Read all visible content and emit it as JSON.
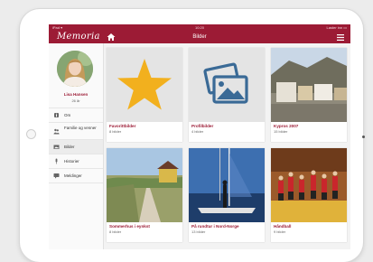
{
  "app": {
    "logo": "Memoria",
    "page_title": "Bilder"
  },
  "statusbar": {
    "left": "iPad ▾",
    "time": "10:20",
    "right": "Laster inn ▭"
  },
  "profile": {
    "name": "Lisa Hansen",
    "age": "26 år"
  },
  "menu": [
    {
      "label": "Om",
      "icon": "info-icon",
      "active": false
    },
    {
      "label": "Familie og venner",
      "icon": "people-icon",
      "active": false
    },
    {
      "label": "Bilder",
      "icon": "photos-icon",
      "active": true
    },
    {
      "label": "Historier",
      "icon": "microphone-icon",
      "active": false
    },
    {
      "label": "Meldinger",
      "icon": "message-icon",
      "active": false
    }
  ],
  "albums": [
    {
      "title": "Favorittbilder",
      "count": "8 bilder",
      "thumb": "star"
    },
    {
      "title": "Profilbilder",
      "count": "4 bilder",
      "thumb": "pictures"
    },
    {
      "title": "Kypros 2007",
      "count": "15 bilder",
      "thumb": "village"
    },
    {
      "title": "Sommerhus i eynkst",
      "count": "8 bilder",
      "thumb": "path"
    },
    {
      "title": "På rundtur i Nord-Norge",
      "count": "13 bilder",
      "thumb": "sailboat"
    },
    {
      "title": "Håndball",
      "count": "9 bilder",
      "thumb": "handball"
    }
  ],
  "colors": {
    "brand": "#9c1b35",
    "star": "#f2b01e",
    "pictures_icon": "#3a6a96"
  }
}
